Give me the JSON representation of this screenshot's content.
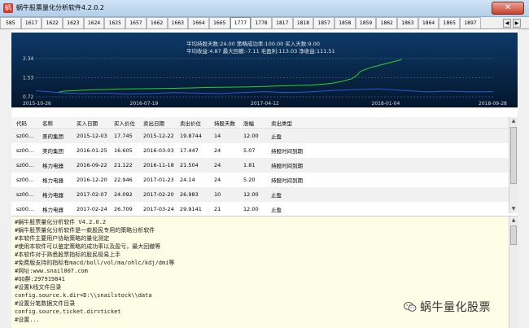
{
  "window": {
    "title": "蜗牛股票量化分析软件4.2.0.2",
    "close_glyph": "✕"
  },
  "tabs": [
    "585",
    "1617",
    "1622",
    "1623",
    "1624",
    "1625",
    "1657",
    "1662",
    "1663",
    "1664",
    "1665",
    "1777",
    "1778",
    "1817",
    "1818",
    "1857",
    "1858",
    "1859",
    "1862",
    "1863",
    "1864",
    "1865",
    "1897"
  ],
  "active_tab": "1777",
  "chart": {
    "stats_line1": "平均持股天数:24.00  策略成功率:100.00  买入天数:9.00",
    "stats_line2": "平均收益:4.87  最大回撤:-7.11  毛盈利:113.03  净收益:111.51",
    "bg_top": "#0d3a68",
    "bg_bottom": "#04162d",
    "green": "#2bd12b",
    "blue": "#2a5bd7"
  },
  "chart_data": {
    "type": "line",
    "y_ticks": [
      "2.34",
      "1.53",
      "0.72"
    ],
    "ylim": [
      0.72,
      2.34
    ],
    "x_ticks": [
      "2015-10-26",
      "2016-07-19",
      "2017-04-12",
      "2018-01-04",
      "2018-09-28"
    ],
    "series": [
      {
        "color": "#2bd12b",
        "points": [
          [
            0.05,
            0.92
          ],
          [
            0.06,
            0.96
          ],
          [
            0.08,
            0.98
          ],
          [
            0.1,
            1.0
          ],
          [
            0.12,
            1.02
          ],
          [
            0.15,
            1.03
          ],
          [
            0.18,
            1.05
          ],
          [
            0.22,
            1.06
          ],
          [
            0.26,
            1.07
          ],
          [
            0.3,
            1.08
          ],
          [
            0.34,
            1.1
          ],
          [
            0.38,
            1.12
          ],
          [
            0.42,
            1.13
          ],
          [
            0.46,
            1.14
          ],
          [
            0.5,
            1.16
          ],
          [
            0.53,
            1.18
          ],
          [
            0.56,
            1.2
          ],
          [
            0.6,
            1.22
          ],
          [
            0.63,
            1.26
          ],
          [
            0.65,
            1.3
          ],
          [
            0.67,
            1.38
          ],
          [
            0.69,
            1.48
          ],
          [
            0.7,
            1.6
          ],
          [
            0.71,
            1.8
          ],
          [
            0.73,
            1.95
          ],
          [
            0.75,
            2.05
          ],
          [
            0.77,
            2.15
          ],
          [
            0.79,
            2.25
          ],
          [
            0.8,
            2.3
          ]
        ]
      },
      {
        "color": "#2a5bd7",
        "points": [
          [
            0.0,
            0.98
          ],
          [
            0.05,
            0.9
          ],
          [
            0.1,
            0.86
          ],
          [
            0.15,
            0.88
          ],
          [
            0.2,
            0.84
          ],
          [
            0.25,
            0.86
          ],
          [
            0.3,
            0.9
          ],
          [
            0.35,
            0.88
          ],
          [
            0.4,
            0.86
          ],
          [
            0.45,
            0.9
          ],
          [
            0.5,
            0.94
          ],
          [
            0.55,
            0.9
          ],
          [
            0.6,
            0.93
          ],
          [
            0.65,
            0.99
          ],
          [
            0.7,
            1.03
          ],
          [
            0.75,
            1.06
          ],
          [
            0.78,
            1.02
          ],
          [
            0.82,
            0.97
          ],
          [
            0.86,
            0.93
          ],
          [
            0.9,
            0.96
          ],
          [
            0.95,
            0.93
          ],
          [
            1.0,
            0.94
          ]
        ]
      }
    ]
  },
  "table": {
    "columns": [
      "代码",
      "名称",
      "买入日期",
      "买入价位",
      "卖出日期",
      "卖出价位",
      "持股天数",
      "涨幅",
      "卖出类型"
    ],
    "rows": [
      [
        "sz00...",
        "美的集团",
        "2015-12-03",
        "17.745",
        "2015-12-22",
        "19.8744",
        "14",
        "12.00",
        "止盈"
      ],
      [
        "sz00...",
        "美的集团",
        "2016-01-25",
        "16.605",
        "2016-03-03",
        "17.447",
        "24",
        "5.07",
        "持股时间到期"
      ],
      [
        "sz00...",
        "格力电器",
        "2016-09-22",
        "21.122",
        "2016-11-18",
        "21.504",
        "24",
        "1.81",
        "持股时间到期"
      ],
      [
        "sz00...",
        "格力电器",
        "2016-12-20",
        "22.946",
        "2017-01-23",
        "24.14",
        "24",
        "5.20",
        "持股时间到期"
      ],
      [
        "sz00...",
        "格力电器",
        "2017-02-07",
        "24.092",
        "2017-02-20",
        "26.983",
        "10",
        "12.00",
        "止盈"
      ],
      [
        "sz00...",
        "格力电器",
        "2017-02-24",
        "26.709",
        "2017-03-24",
        "29.9141",
        "21",
        "12.00",
        "止盈"
      ]
    ]
  },
  "log": {
    "lines": [
      "#蜗牛股票量化分析软件 V4.2.0.2",
      "#蜗牛股票量化分析软件是一款股民专用的策略分析软件",
      "#本软件主要用户协助策略的量化测定",
      "#使用本软件可以鉴定策略的成功率以及盈亏，最大回撤等",
      "#本软件对于熟悉股票指标的股民极易上手",
      "#免费版支持的指标有macd/boll/vol/ma/ohlc/kdj/dmi等",
      "#网址:www.snail007.com",
      "#QQ群:297919841",
      "#设置k线文件目录",
      "config.source.k.dir=D:\\\\snailstock\\\\data",
      "#设置分笔数据文件目录",
      "config.source.ticket.dir=ticket",
      "#设置..."
    ]
  },
  "watermark": "蜗牛量化股票",
  "scroll": {
    "up": "▲",
    "down": "▼"
  },
  "tab_nav": {
    "left": "◀",
    "right": "▶"
  }
}
